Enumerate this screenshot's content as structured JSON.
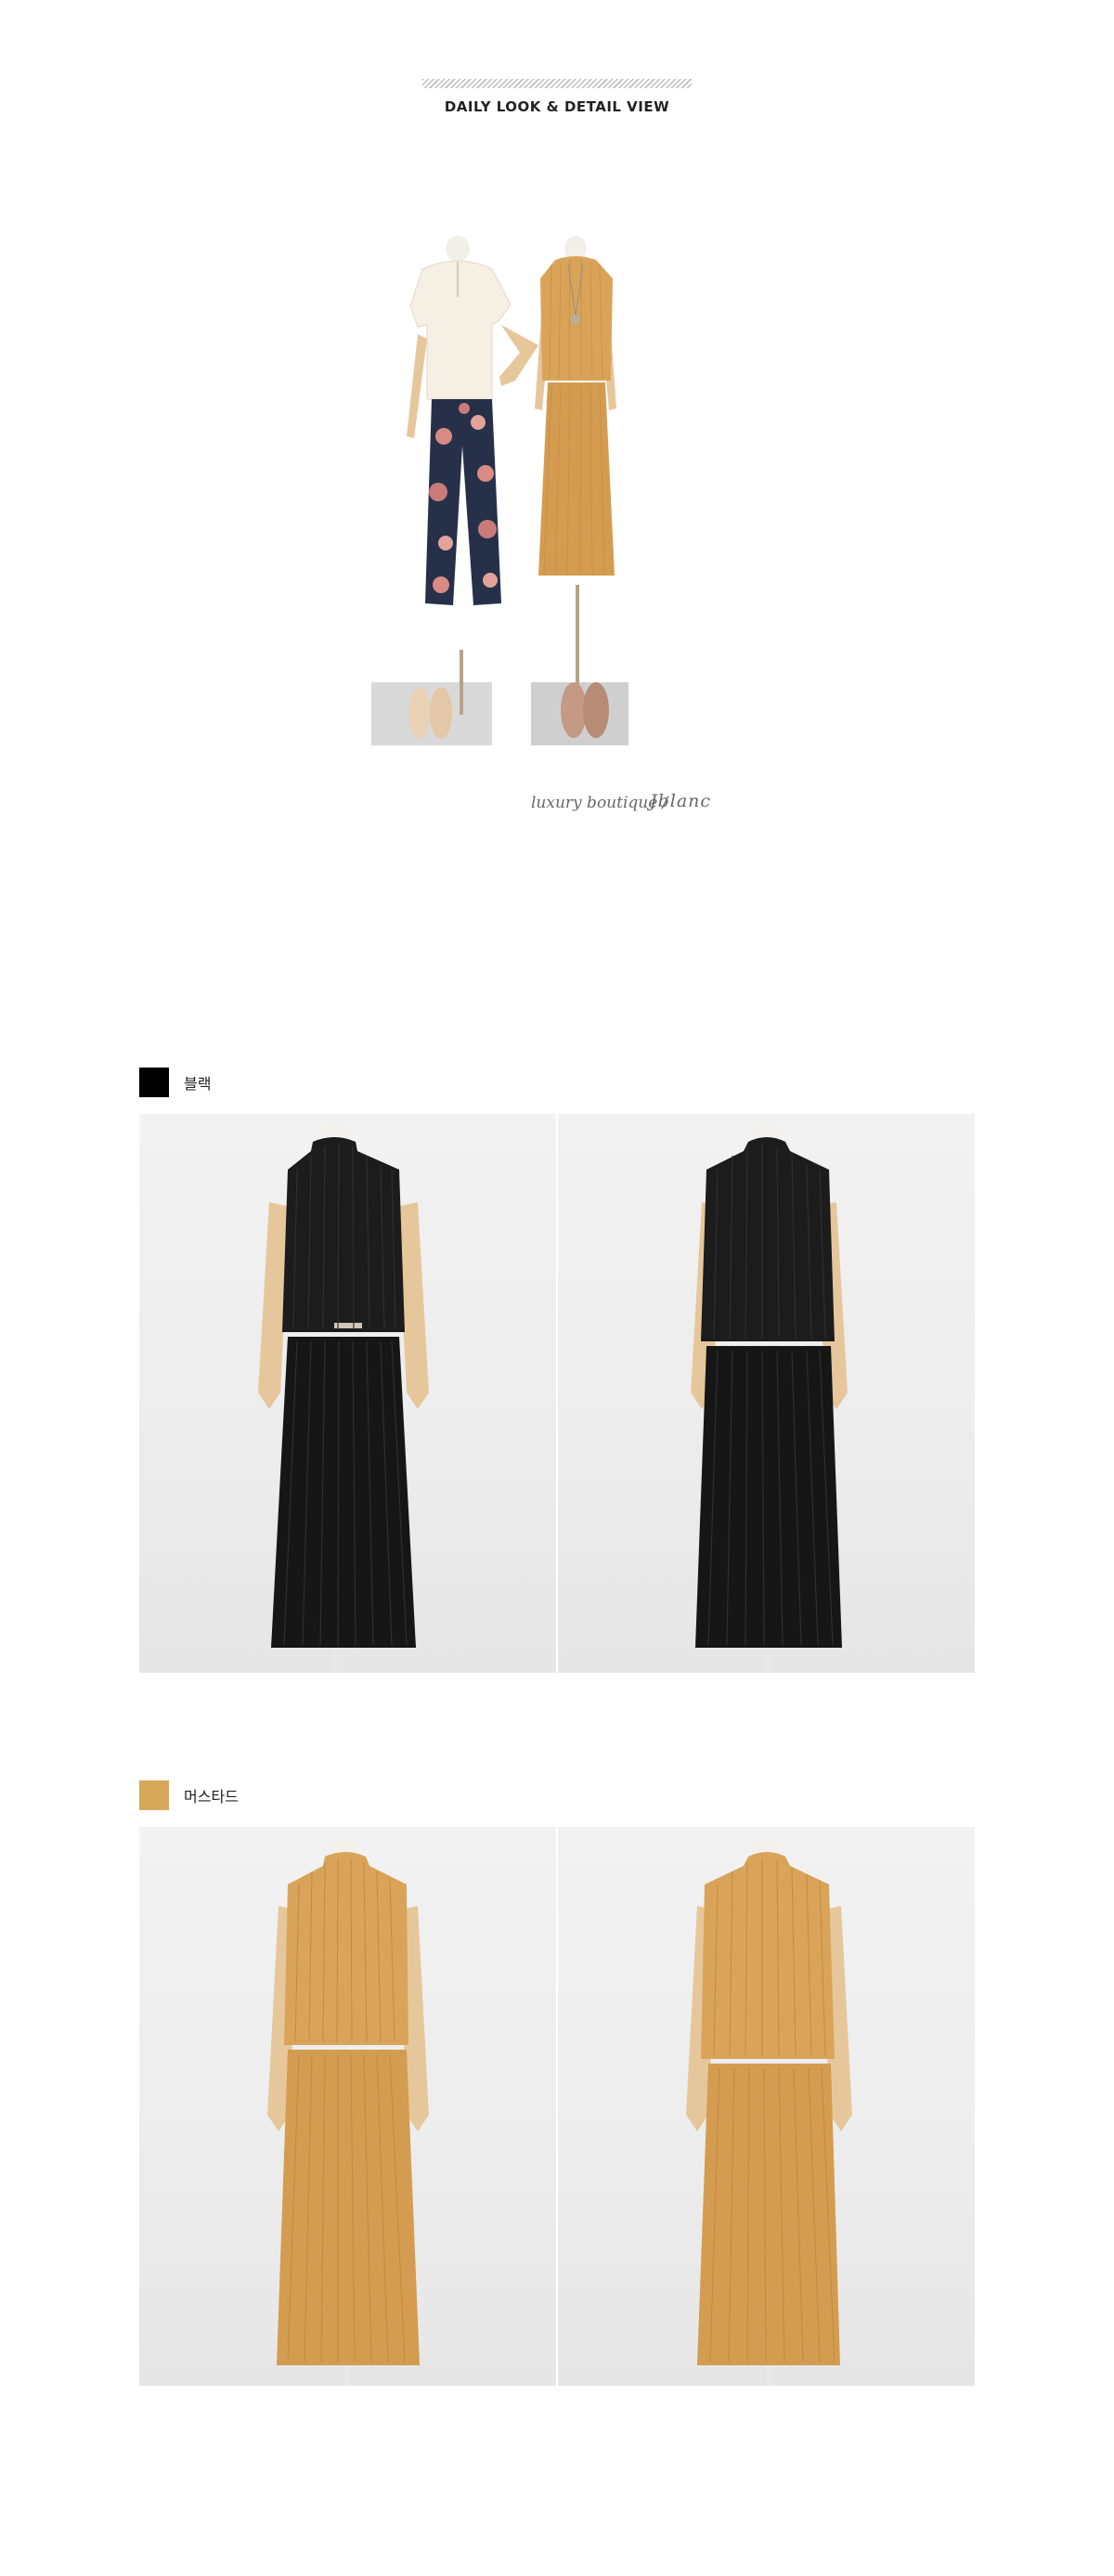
{
  "header": {
    "title": "DAILY LOOK & DETAIL VIEW"
  },
  "hero": {
    "tagline": "luxury boutique  /",
    "signature": "Jblanc"
  },
  "sections": [
    {
      "label": "블랙",
      "color": "#000000",
      "garment": "#1c1c1c"
    },
    {
      "label": "머스타드",
      "color": "#d6a85a",
      "garment": "#d9a45a"
    }
  ],
  "colors": {
    "mustard": "#d9a45a",
    "cream": "#f3ede2",
    "floral_navy": "#263049",
    "floral_pink": "#d88a84",
    "mannequin_wood": "#e6c79b"
  }
}
